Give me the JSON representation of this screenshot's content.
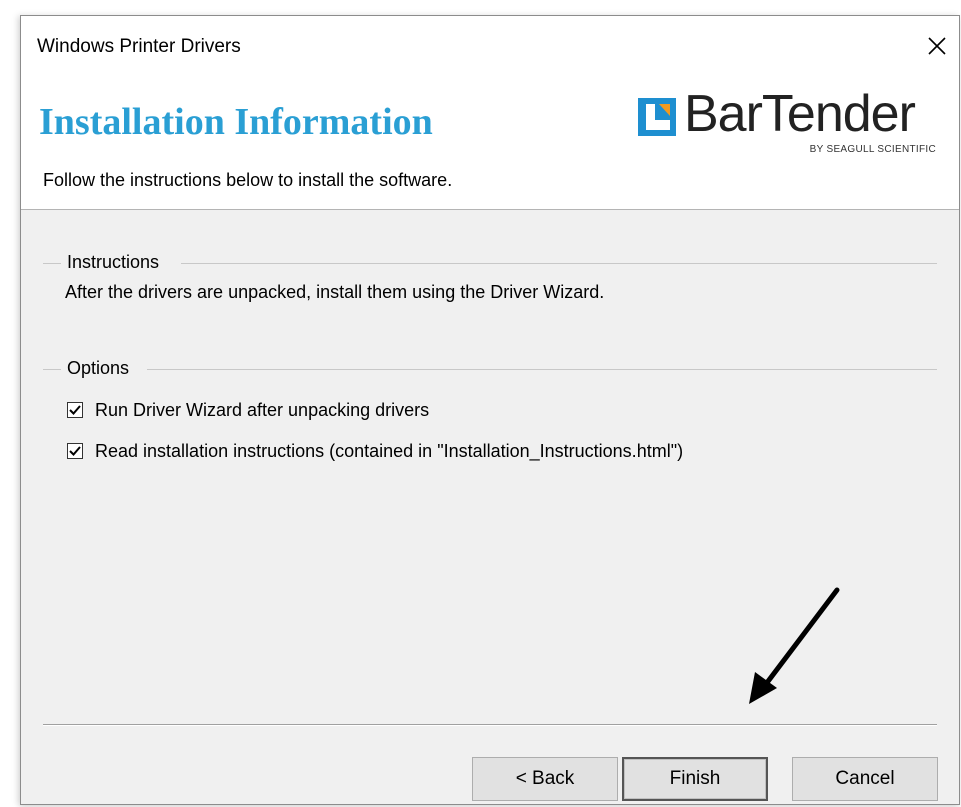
{
  "window": {
    "title": "Windows Printer Drivers"
  },
  "header": {
    "title": "Installation Information",
    "subtitle": "Follow the instructions below to install the software.",
    "logo_text": "BarTender",
    "logo_tagline": "BY SEAGULL SCIENTIFIC",
    "logo_icon": "bartender-logo-icon",
    "accent_color": "#2a9fd4"
  },
  "instructions": {
    "group_label": "Instructions",
    "text": "After the drivers are unpacked, install them using the Driver Wizard."
  },
  "options": {
    "group_label": "Options",
    "items": [
      {
        "label": "Run Driver Wizard after unpacking drivers",
        "checked": true
      },
      {
        "label": "Read installation instructions (contained in \"Installation_Instructions.html\")",
        "checked": true
      }
    ]
  },
  "buttons": {
    "back": "< Back",
    "finish": "Finish",
    "cancel": "Cancel"
  },
  "annotation": {
    "arrow_icon": "pointer-arrow-icon",
    "arrow_color": "#000000"
  }
}
